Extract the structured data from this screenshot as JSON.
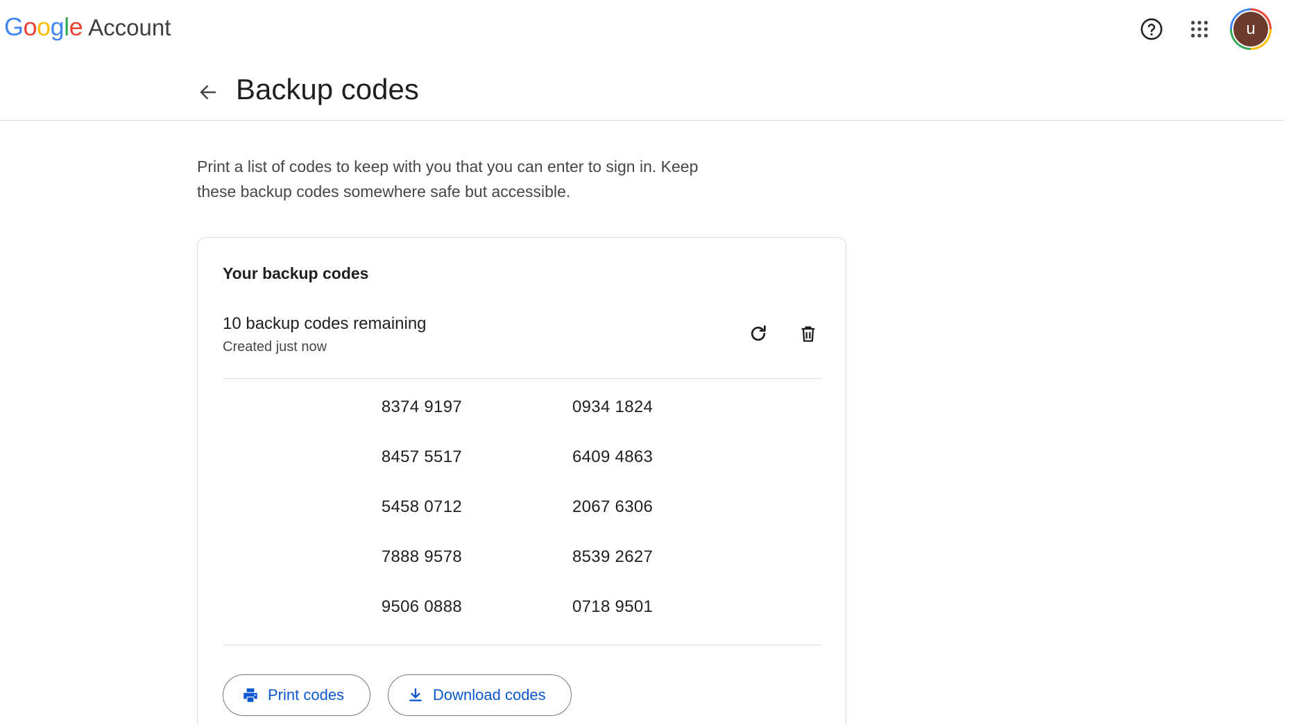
{
  "header": {
    "logo_letters": [
      {
        "ch": "G",
        "color": "#4285f4"
      },
      {
        "ch": "o",
        "color": "#ea4335"
      },
      {
        "ch": "o",
        "color": "#fbbc04"
      },
      {
        "ch": "g",
        "color": "#4285f4"
      },
      {
        "ch": "l",
        "color": "#34a853"
      },
      {
        "ch": "e",
        "color": "#ea4335"
      }
    ],
    "product": "Account",
    "avatar_letter": "u",
    "avatar_color": "#6d3a2e",
    "icons": {
      "help": "help-circle-icon",
      "apps": "apps-grid-icon"
    }
  },
  "page": {
    "title": "Backup codes",
    "back_icon": "arrow-left-icon",
    "intro_line1": "Print a list of codes to keep with you that you can enter to sign in. Keep",
    "intro_line2": "these backup codes somewhere safe but accessible."
  },
  "card": {
    "title": "Your backup codes",
    "remaining": "10 backup codes remaining",
    "created": "Created just now",
    "refresh_icon": "refresh-icon",
    "delete_icon": "trash-icon",
    "codes": [
      [
        "8374 9197",
        "0934 1824"
      ],
      [
        "8457 5517",
        "6409 4863"
      ],
      [
        "5458 0712",
        "2067 6306"
      ],
      [
        "7888 9578",
        "8539 2627"
      ],
      [
        "9506 0888",
        "0718 9501"
      ]
    ],
    "print_label": "Print codes",
    "download_label": "Download codes",
    "accent_color": "#0b57d0"
  }
}
